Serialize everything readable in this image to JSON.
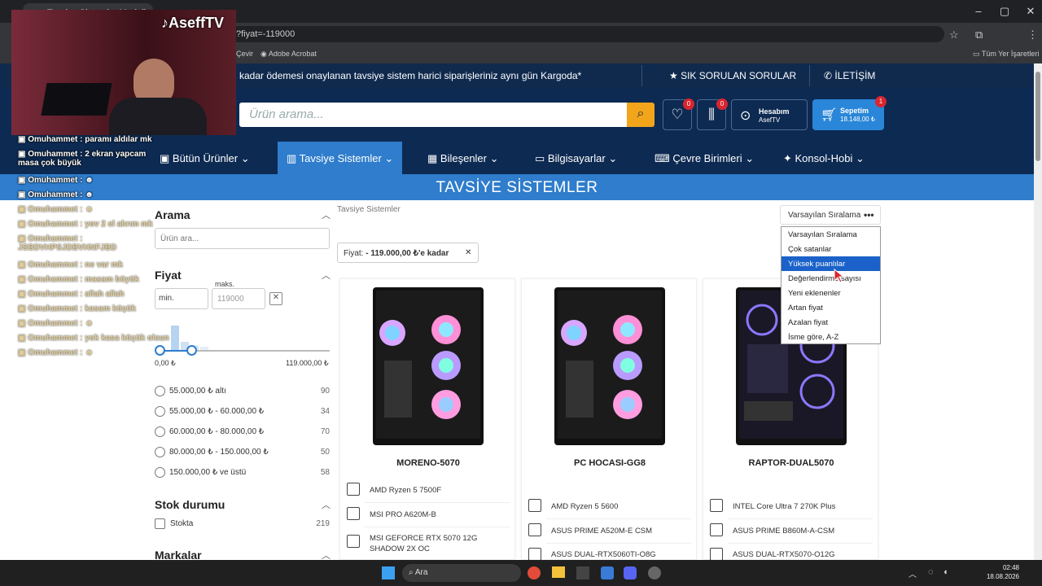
{
  "browser": {
    "tab_title": "Tavsiye Sistemler Modelleri ve",
    "url": "?fiyat=-119000",
    "bookmarks": {
      "translate": "Çevir",
      "acrobat": "Adobe Acrobat",
      "all": "Tüm Yer İşaretleri"
    }
  },
  "site": {
    "topbar": {
      "announcement": "kadar ödemesi onaylanan tavsiye sistem harici siparişleriniz aynı gün Kargoda*",
      "faq": "SIK SORULAN SORULAR",
      "contact": "İLETİŞİM"
    },
    "search_placeholder": "Ürün arama...",
    "favorites_count": "0",
    "compare_count": "0",
    "account": {
      "label": "Hesabım",
      "user": "AsefTV"
    },
    "cart": {
      "label": "Sepetim",
      "total": "18.148,00 ₺",
      "count": "1"
    },
    "nav": [
      "Bütün Ürünler",
      "Tavsiye Sistemler",
      "Bileşenler",
      "Bilgisayarlar",
      "Çevre Birimleri",
      "Konsol-Hobi"
    ],
    "page_title": "TAVSİYE SİSTEMLER"
  },
  "sidebar": {
    "search_heading": "Arama",
    "search_placeholder": "Ürün ara...",
    "price_heading": "Fiyat",
    "min_placeholder": "min.",
    "max_label": "maks.",
    "max_value": "119000",
    "range_min": "0,00 ₺",
    "range_max": "119.000,00 ₺",
    "price_ranges": [
      {
        "label": "55.000,00 ₺ altı",
        "count": "90"
      },
      {
        "label": "55.000,00 ₺ - 60.000,00 ₺",
        "count": "34"
      },
      {
        "label": "60.000,00 ₺ - 80.000,00 ₺",
        "count": "70"
      },
      {
        "label": "80.000,00 ₺ - 150.000,00 ₺",
        "count": "50"
      },
      {
        "label": "150.000,00 ₺ ve üstü",
        "count": "58"
      }
    ],
    "stock_heading": "Stok durumu",
    "stock_label": "Stokta",
    "stock_count": "219",
    "brands_heading": "Markalar"
  },
  "content": {
    "breadcrumb": "Tavsiye Sistemler",
    "filter_chip_prefix": "Fiyat:",
    "filter_chip_value": "- 119.000,00 ₺'e kadar",
    "sort_selected": "Varsayılan Sıralama",
    "sort_options": [
      "Varsayılan Sıralama",
      "Çok satanlar",
      "Yüksek puanlılar",
      "Değerlendirme sayısı",
      "Yeni eklenenler",
      "Artan fiyat",
      "Azalan fiyat",
      "İsme göre, A-Z"
    ],
    "products": [
      {
        "name": "MORENO-5070",
        "specs": [
          "AMD Ryzen 5 7500F",
          "MSI PRO A620M-B",
          "MSI GEFORCE RTX 5070 12G SHADOW 2X OC"
        ]
      },
      {
        "name": "PC HOCASI-GG8",
        "specs": [
          "AMD Ryzen 5 5600",
          "ASUS PRIME A520M-E CSM",
          "ASUS DUAL-RTX5060TI-O8G"
        ]
      },
      {
        "name": "RAPTOR-DUAL5070",
        "specs": [
          "INTEL Core Ultra 7 270K Plus",
          "ASUS PRIME B860M-A-CSM",
          "ASUS DUAL-RTX5070-O12G"
        ]
      }
    ]
  },
  "stream": {
    "channel": "AseffTV",
    "chat": [
      {
        "user": "Omuhammet",
        "msg": "paramı aldılar mk"
      },
      {
        "user": "Omuhammet",
        "msg": "2 ekran yapcam masa çok büyük"
      },
      {
        "user": "Omuhammet",
        "msg": ""
      },
      {
        "user": "Omuhammet",
        "msg": ""
      },
      {
        "user": "Omuhammet",
        "msg": ""
      },
      {
        "user": "Omuhammet",
        "msg": "yov 2 el alırım mk"
      },
      {
        "user": "Omuhammet",
        "msg": "JSBDVHPSJDBVHNFJBD"
      },
      {
        "user": "Omuhammet",
        "msg": "ne var mk"
      },
      {
        "user": "Omuhammet",
        "msg": "masam büyük"
      },
      {
        "user": "Omuhammet",
        "msg": "allah allah"
      },
      {
        "user": "Omuhammet",
        "msg": "kasam küçük"
      },
      {
        "user": "Omuhammet",
        "msg": ""
      },
      {
        "user": "Omuhammet",
        "msg": "yok kasa küçük olsun"
      },
      {
        "user": "Omuhammet",
        "msg": ""
      }
    ]
  },
  "taskbar": {
    "search": "Ara",
    "time": "02:48",
    "date": "18.08.2026"
  },
  "colors": {
    "navy": "#0d2a52",
    "blue": "#2f7dcc",
    "orange": "#f2a51a",
    "badge": "#d9252f"
  }
}
